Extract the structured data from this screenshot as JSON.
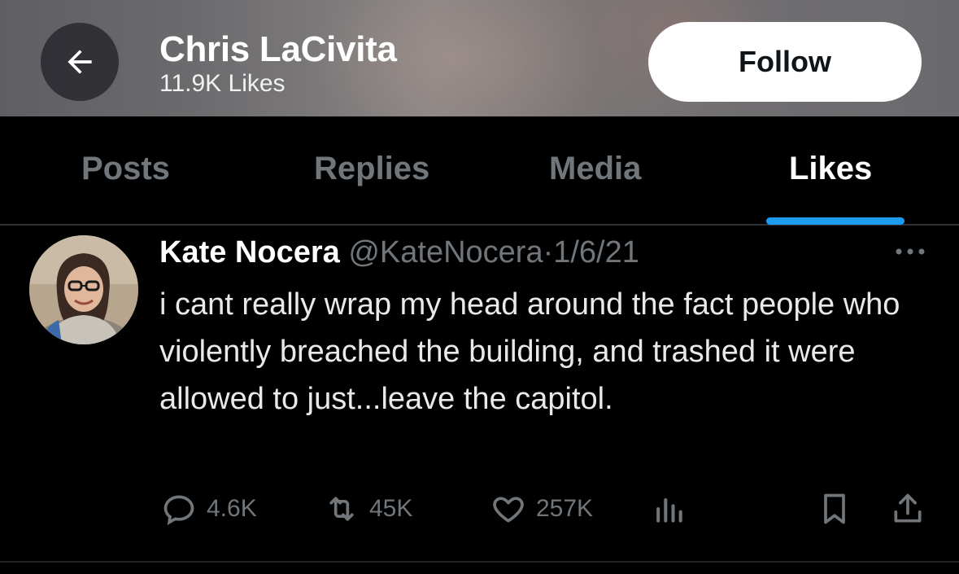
{
  "profile": {
    "name": "Chris LaCivita",
    "likes_count": "11.9K Likes",
    "follow_label": "Follow"
  },
  "tabs": [
    {
      "label": "Posts",
      "active": false
    },
    {
      "label": "Replies",
      "active": false
    },
    {
      "label": "Media",
      "active": false
    },
    {
      "label": "Likes",
      "active": true
    }
  ],
  "tweet": {
    "author": "Kate Nocera",
    "handle": "@KateNocera",
    "separator": "·",
    "date": "1/6/21",
    "text": "i cant really wrap my head around the fact people who violently breached the building, and trashed it were allowed to just...leave the capitol.",
    "replies": "4.6K",
    "reposts": "45K",
    "likes": "257K"
  },
  "icons": {
    "back": "arrow-left-icon",
    "more": "more-horizontal-icon",
    "reply": "reply-icon",
    "repost": "repost-icon",
    "like": "heart-icon",
    "views": "views-chart-icon",
    "bookmark": "bookmark-icon",
    "share": "share-icon"
  },
  "colors": {
    "background": "#000000",
    "accent": "#1d9bf0",
    "muted_text": "#71767b",
    "primary_text": "#e7e9ea"
  }
}
